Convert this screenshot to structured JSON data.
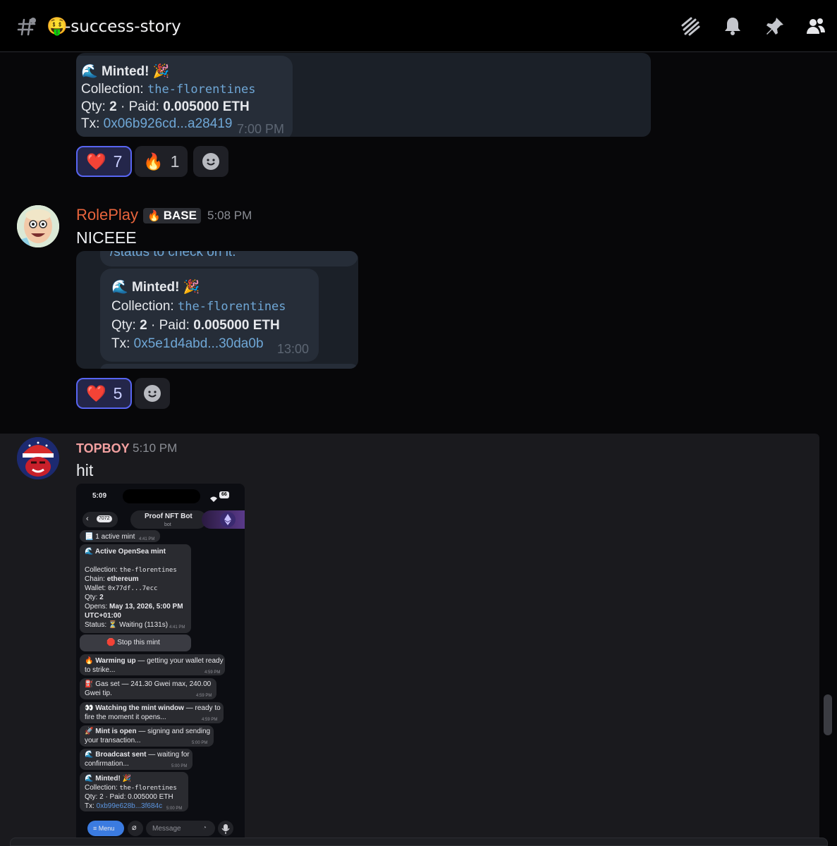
{
  "channel": {
    "name": "-success-story",
    "emoji": "🤑",
    "icons": [
      "threads-icon",
      "bell-icon",
      "pin-icon",
      "members-icon"
    ]
  },
  "embed1": {
    "title": "Minted!",
    "collection_label": "Collection:",
    "collection": "the-florentines",
    "qty_line_label": "Qty:",
    "qty": "2",
    "paid_label": "· Paid:",
    "paid": "0.005000 ETH",
    "tx_label": "Tx:",
    "tx": "0x06b926cd...a28419",
    "time": "7:00 PM"
  },
  "reactions1": [
    {
      "emoji": "❤️",
      "count": "7",
      "active": true
    },
    {
      "emoji": "🔥",
      "count": "1",
      "active": false
    }
  ],
  "message2": {
    "username": "RolePlay",
    "username_color": "#e8643c",
    "tag": "BASE",
    "time": "5:08 PM",
    "text": "NICEEE",
    "embed": {
      "cut_text": "/status to check on it.",
      "title": "Minted!",
      "collection_label": "Collection:",
      "collection": "the-florentines",
      "qty_line_label": "Qty:",
      "qty": "2",
      "paid_label": "· Paid:",
      "paid": "0.005000 ETH",
      "tx_label": "Tx:",
      "tx": "0x5e1d4abd...30da0b",
      "time": "13:00"
    },
    "reactions": [
      {
        "emoji": "❤️",
        "count": "5",
        "active": true
      }
    ]
  },
  "message3": {
    "username": "TOPBOY",
    "username_color": "#f2a0a0",
    "time": "5:10 PM",
    "text": "hit",
    "phone": {
      "clock": "5:09",
      "battery": "66",
      "back_count": "7072",
      "bot_name": "Proof NFT Bot",
      "bot_sub": "bot",
      "active_mint": "1 active mint",
      "active_mint_time": "4:41 PM",
      "card_title": "Active OpenSea mint",
      "card_collection_label": "Collection:",
      "card_collection": "the-florentines",
      "card_chain_label": "Chain:",
      "card_chain": "ethereum",
      "card_wallet_label": "Wallet:",
      "card_wallet": "0x77df...7ecc",
      "card_qty_label": "Qty:",
      "card_qty": "2",
      "card_opens_label": "Opens:",
      "card_opens": "May 13, 2026, 5:00 PM",
      "card_tz": "UTC+01:00",
      "card_status_label": "Status:",
      "card_status": "Waiting (1131s)",
      "card_time": "4:41 PM",
      "stop_button": "Stop this mint",
      "steps": [
        {
          "icon": "🔥",
          "bold": "Warming up",
          "rest": " — getting your wallet ready",
          "line2": "to strike...",
          "time": "4:59 PM"
        },
        {
          "icon": "⛽",
          "bold": "",
          "rest": "Gas set — 241.30 Gwei max, 240.00",
          "line2": "Gwei tip.",
          "time": "4:59 PM"
        },
        {
          "icon": "👀",
          "bold": "Watching the mint window",
          "rest": " — ready to",
          "line2": "fire the moment it opens...",
          "time": "4:59 PM"
        },
        {
          "icon": "🚀",
          "bold": "Mint is open",
          "rest": " — signing and sending",
          "line2": "your transaction...",
          "time": "5:00 PM"
        },
        {
          "icon": "🌊",
          "bold": "Broadcast sent",
          "rest": " — waiting for",
          "line2": "confirmation...",
          "time": "5:00 PM"
        }
      ],
      "final_title": "Minted!",
      "final_collection_label": "Collection:",
      "final_collection": "the-florentines",
      "final_qty": "Qty: 2 · Paid: 0.005000 ETH",
      "final_tx_label": "Tx:",
      "final_tx": "0xb99e628b...3f684c",
      "final_time": "5:00 PM",
      "menu_label": "Menu",
      "input_placeholder": "Message"
    }
  }
}
